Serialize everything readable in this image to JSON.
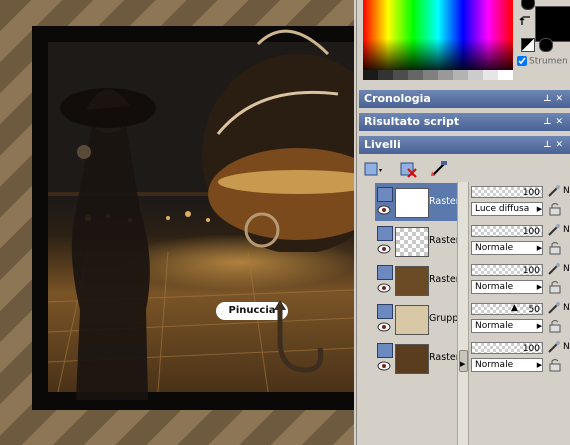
{
  "canvas": {
    "watermark_tag": "Pinuccia"
  },
  "color_palette": {
    "strumenti_label": "Strumen",
    "grayscale": [
      "#1a1a1a",
      "#333333",
      "#4d4d4d",
      "#666666",
      "#808080",
      "#999999",
      "#b3b3b3",
      "#cccccc",
      "#e6e6e6",
      "#ffffff"
    ]
  },
  "panels": {
    "history_title": "Cronologia",
    "script_title": "Risultato script",
    "layers_title": "Livelli"
  },
  "layers": [
    {
      "name": "Raster",
      "opacity": "100",
      "blend": "Luce diffusa",
      "selected": true,
      "n": "N"
    },
    {
      "name": "Raster",
      "opacity": "100",
      "blend": "Normale",
      "selected": false,
      "n": "N"
    },
    {
      "name": "Raster",
      "opacity": "100",
      "blend": "Normale",
      "selected": false,
      "n": "N"
    },
    {
      "name": "Gruppo",
      "opacity": "50",
      "blend": "Normale",
      "selected": false,
      "n": "N"
    },
    {
      "name": "Raster",
      "opacity": "100",
      "blend": "Normale",
      "selected": false,
      "n": "N"
    }
  ],
  "colors": {
    "title_bar": "#5a73a6",
    "selection": "#5b79ad"
  },
  "icons": {
    "panel_pin": "pin-icon",
    "panel_close": "close-icon",
    "visibility": "eye-icon",
    "edit": "pen-icon",
    "lock": "lock-icon"
  }
}
